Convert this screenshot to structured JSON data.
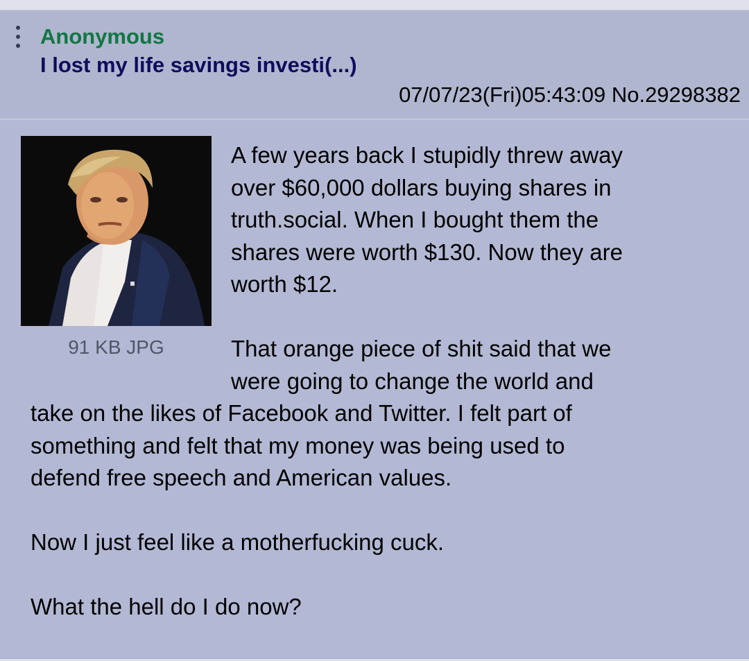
{
  "post": {
    "name": "Anonymous",
    "subject": "I lost my life savings investi(...)",
    "datetime": "07/07/23(Fri)05:43:09",
    "post_number": "No.29298382",
    "file_info": "91 KB JPG",
    "thumbnail_icon": "post-image-thumbnail",
    "paragraphs": [
      [
        "A few years back I stupidly threw away",
        "over $60,000 dollars buying shares in",
        "truth.social. When I bought them the",
        "shares were worth $130. Now they are",
        "worth $12."
      ],
      [
        "That orange piece of shit said that we",
        "were going to change the world and",
        "take on the likes of Facebook and Twitter. I felt part of",
        "something and felt that my money was being used to",
        "defend free speech and American values."
      ],
      [
        "Now I just feel like a motherfucking cuck."
      ],
      [
        "What the hell do I do now?"
      ]
    ]
  },
  "colors": {
    "page_bg": "#dfe1ea",
    "post_bg": "#b3b9d4",
    "name": "#117743",
    "subject": "#0f0c5d"
  }
}
